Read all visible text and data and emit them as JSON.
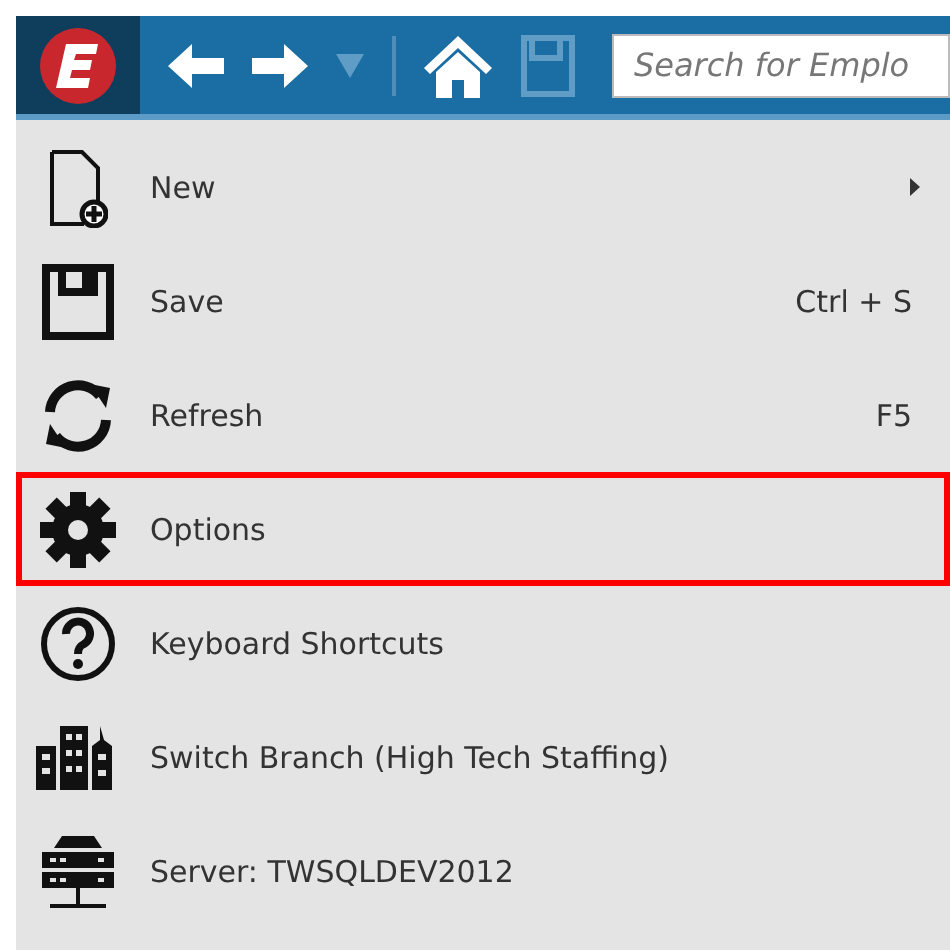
{
  "toolbar": {
    "buttons": [
      {
        "kind": "back",
        "disabled": false
      },
      {
        "kind": "forward",
        "disabled": false
      },
      {
        "kind": "dropdown",
        "disabled": true
      },
      {
        "kind": "separator"
      },
      {
        "kind": "home",
        "disabled": false
      },
      {
        "kind": "save",
        "disabled": true
      }
    ],
    "search": {
      "placeholder": "Search for Emplo"
    }
  },
  "menu": {
    "items": [
      {
        "kind": "new",
        "label": "New",
        "submenu": true,
        "highlighted": false
      },
      {
        "kind": "save",
        "label": "Save",
        "shortcut": "Ctrl + S",
        "highlighted": false
      },
      {
        "kind": "refresh",
        "label": "Refresh",
        "shortcut": "F5",
        "highlighted": false
      },
      {
        "kind": "options",
        "label": "Options",
        "highlighted": true
      },
      {
        "kind": "help",
        "label": "Keyboard Shortcuts",
        "highlighted": false
      },
      {
        "kind": "branch",
        "label": "Switch Branch (High Tech Staffing)",
        "highlighted": false
      },
      {
        "kind": "server",
        "label": "Server: TWSQLDEV2012",
        "highlighted": false
      }
    ]
  }
}
